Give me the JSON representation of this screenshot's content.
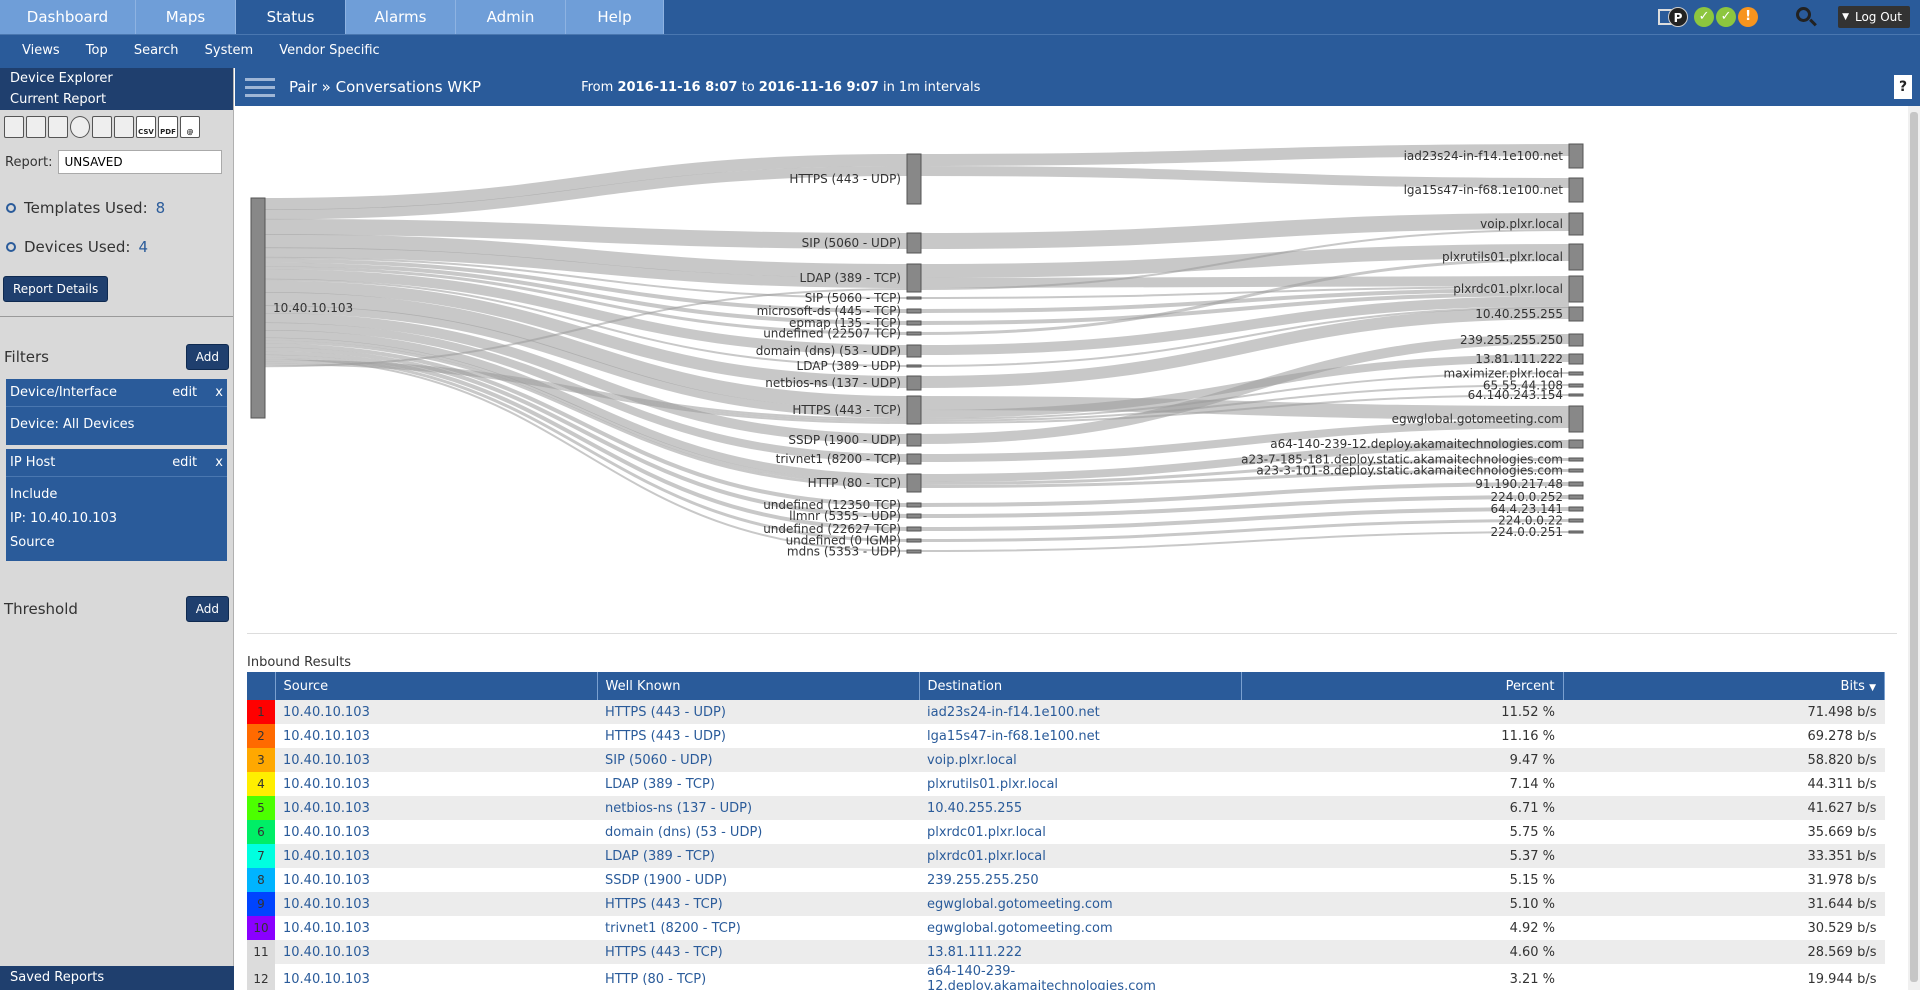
{
  "nav": {
    "tabs": [
      {
        "label": "Dashboard"
      },
      {
        "label": "Maps"
      },
      {
        "label": "Status"
      },
      {
        "label": "Alarms"
      },
      {
        "label": "Admin"
      },
      {
        "label": "Help"
      }
    ],
    "active_tab": "Status",
    "p_badge": "P",
    "status_icons": [
      {
        "glyph": "✓",
        "color": "#8dc63f"
      },
      {
        "glyph": "✓",
        "color": "#8dc63f"
      },
      {
        "glyph": "!",
        "color": "#f7941d"
      }
    ],
    "logout_label": "Log Out"
  },
  "subnav": {
    "items": [
      "Views",
      "Top",
      "Search",
      "System",
      "Vendor Specific"
    ]
  },
  "sidebar": {
    "device_explorer": "Device Explorer",
    "current_report": "Current Report",
    "toolbar_icons": [
      "trash-icon",
      "save-icon",
      "save-as-icon",
      "clock-icon",
      "grid-icon",
      "print-icon",
      "csv-icon",
      "pdf-icon",
      "email-icon"
    ],
    "toolbar_labels": {
      "csv": "CSV",
      "pdf": "PDF",
      "email": "@"
    },
    "report_label": "Report:",
    "report_value": "UNSAVED",
    "templates_label": "Templates Used:",
    "templates_count": "8",
    "devices_label": "Devices Used:",
    "devices_count": "4",
    "report_details": "Report Details",
    "filters_label": "Filters",
    "add_label": "Add",
    "filter_cards": [
      {
        "title": "Device/Interface",
        "edit": "edit",
        "close": "x",
        "lines": [
          "Device: All Devices"
        ]
      },
      {
        "title": "IP Host",
        "edit": "edit",
        "close": "x",
        "lines": [
          "Include",
          "IP: 10.40.10.103",
          "Source"
        ]
      }
    ],
    "threshold_label": "Threshold",
    "saved_reports": "Saved Reports"
  },
  "header": {
    "breadcrumb": "Pair » Conversations WKP",
    "range_from_label": "From",
    "range_from": "2016-11-16 8:07",
    "range_to_label": "to",
    "range_to": "2016-11-16 9:07",
    "range_interval": "in 1m intervals",
    "help": "?"
  },
  "sankey": {
    "source": "10.40.10.103",
    "middle": [
      "HTTPS (443 - UDP)",
      "SIP (5060 - UDP)",
      "LDAP (389 - TCP)",
      "SIP (5060 - TCP)",
      "microsoft-ds (445 - TCP)",
      "epmap (135 - TCP)",
      "undefined (22507 TCP)",
      "domain (dns) (53 - UDP)",
      "LDAP (389 - UDP)",
      "netbios-ns (137 - UDP)",
      "HTTPS (443 - TCP)",
      "SSDP (1900 - UDP)",
      "trivnet1 (8200 - TCP)",
      "HTTP (80 - TCP)",
      "undefined (12350 TCP)",
      "llmnr (5355 - UDP)",
      "undefined (22627 TCP)",
      "undefined (0 IGMP)",
      "mdns (5353 - UDP)"
    ],
    "destinations": [
      "iad23s24-in-f14.1e100.net",
      "lga15s47-in-f68.1e100.net",
      "voip.plxr.local",
      "plxrutils01.plxr.local",
      "plxrdc01.plxr.local",
      "10.40.255.255",
      "239.255.255.250",
      "13.81.111.222",
      "maximizer.plxr.local",
      "65.55.44.108",
      "64.140.243.154",
      "egwglobal.gotomeeting.com",
      "a64-140-239-12.deploy.akamaitechnologies.com",
      "a23-7-185-181.deploy.static.akamaitechnologies.com",
      "a23-3-101-8.deploy.static.akamaitechnologies.com",
      "91.190.217.48",
      "224.0.0.252",
      "64.4.23.141",
      "224.0.0.22",
      "224.0.0.251"
    ]
  },
  "results": {
    "title": "Inbound Results",
    "columns": {
      "source": "Source",
      "well_known": "Well Known",
      "destination": "Destination",
      "percent": "Percent",
      "bits": "Bits"
    },
    "rows": [
      {
        "rank": "1",
        "color": "#ff0000",
        "source": "10.40.10.103",
        "well_known": "HTTPS (443 - UDP)",
        "destination": "iad23s24-in-f14.1e100.net",
        "percent": "11.52 %",
        "bits": "71.498 b/s"
      },
      {
        "rank": "2",
        "color": "#ff6a00",
        "source": "10.40.10.103",
        "well_known": "HTTPS (443 - UDP)",
        "destination": "lga15s47-in-f68.1e100.net",
        "percent": "11.16 %",
        "bits": "69.278 b/s"
      },
      {
        "rank": "3",
        "color": "#ffa800",
        "source": "10.40.10.103",
        "well_known": "SIP (5060 - UDP)",
        "destination": "voip.plxr.local",
        "percent": "9.47 %",
        "bits": "58.820 b/s"
      },
      {
        "rank": "4",
        "color": "#ffee00",
        "source": "10.40.10.103",
        "well_known": "LDAP (389 - TCP)",
        "destination": "plxrutils01.plxr.local",
        "percent": "7.14 %",
        "bits": "44.311 b/s"
      },
      {
        "rank": "5",
        "color": "#4cff00",
        "source": "10.40.10.103",
        "well_known": "netbios-ns (137 - UDP)",
        "destination": "10.40.255.255",
        "percent": "6.71 %",
        "bits": "41.627 b/s"
      },
      {
        "rank": "6",
        "color": "#00ee66",
        "source": "10.40.10.103",
        "well_known": "domain (dns) (53 - UDP)",
        "destination": "plxrdc01.plxr.local",
        "percent": "5.75 %",
        "bits": "35.669 b/s"
      },
      {
        "rank": "7",
        "color": "#00ffe0",
        "source": "10.40.10.103",
        "well_known": "LDAP (389 - TCP)",
        "destination": "plxrdc01.plxr.local",
        "percent": "5.37 %",
        "bits": "33.351 b/s"
      },
      {
        "rank": "8",
        "color": "#00b4ff",
        "source": "10.40.10.103",
        "well_known": "SSDP (1900 - UDP)",
        "destination": "239.255.255.250",
        "percent": "5.15 %",
        "bits": "31.978 b/s"
      },
      {
        "rank": "9",
        "color": "#0044ff",
        "source": "10.40.10.103",
        "well_known": "HTTPS (443 - TCP)",
        "destination": "egwglobal.gotomeeting.com",
        "percent": "5.10 %",
        "bits": "31.644 b/s"
      },
      {
        "rank": "10",
        "color": "#8a00ff",
        "source": "10.40.10.103",
        "well_known": "trivnet1 (8200 - TCP)",
        "destination": "egwglobal.gotomeeting.com",
        "percent": "4.92 %",
        "bits": "30.529 b/s"
      },
      {
        "rank": "11",
        "color": "#dcdcdc",
        "source": "10.40.10.103",
        "well_known": "HTTPS (443 - TCP)",
        "destination": "13.81.111.222",
        "percent": "4.60 %",
        "bits": "28.569 b/s"
      },
      {
        "rank": "12",
        "color": "#dcdcdc",
        "source": "10.40.10.103",
        "well_known": "HTTP (80 - TCP)",
        "destination": "a64-140-239-12.deploy.akamaitechnologies.com",
        "percent": "3.21 %",
        "bits": "19.944 b/s"
      }
    ]
  }
}
